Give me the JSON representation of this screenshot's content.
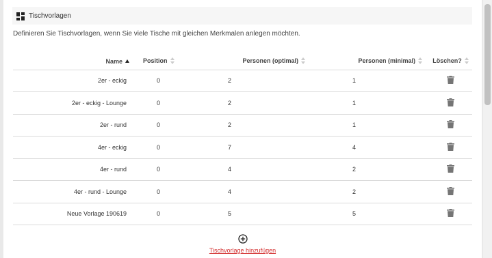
{
  "header": {
    "title": "Tischvorlagen",
    "icon": "dashboard-icon"
  },
  "description": "Definieren Sie Tischvorlagen, wenn Sie viele Tische mit gleichen Merkmalen anlegen möchten.",
  "table": {
    "columns": {
      "name": "Name",
      "position": "Position",
      "persons_optimal": "Personen (optimal)",
      "persons_minimal": "Personen (minimal)",
      "delete": "Löschen?"
    },
    "sort": {
      "column": "name",
      "direction": "ascending"
    },
    "rows": [
      {
        "name": "2er - eckig",
        "position": "0",
        "persons_optimal": "2",
        "persons_minimal": "1"
      },
      {
        "name": "2er - eckig - Lounge",
        "position": "0",
        "persons_optimal": "2",
        "persons_minimal": "1"
      },
      {
        "name": "2er - rund",
        "position": "0",
        "persons_optimal": "2",
        "persons_minimal": "1"
      },
      {
        "name": "4er - eckig",
        "position": "0",
        "persons_optimal": "7",
        "persons_minimal": "4"
      },
      {
        "name": "4er - rund",
        "position": "0",
        "persons_optimal": "4",
        "persons_minimal": "2"
      },
      {
        "name": "4er - rund - Lounge",
        "position": "0",
        "persons_optimal": "4",
        "persons_minimal": "2"
      },
      {
        "name": "Neue Vorlage 190619",
        "position": "0",
        "persons_optimal": "5",
        "persons_minimal": "5"
      }
    ]
  },
  "add": {
    "label": "Tischvorlage hinzufügen",
    "icon": "add-circle-icon"
  },
  "colors": {
    "link": "#d32f2f",
    "header_bg": "#f6f6f6",
    "trash": "#757575"
  }
}
